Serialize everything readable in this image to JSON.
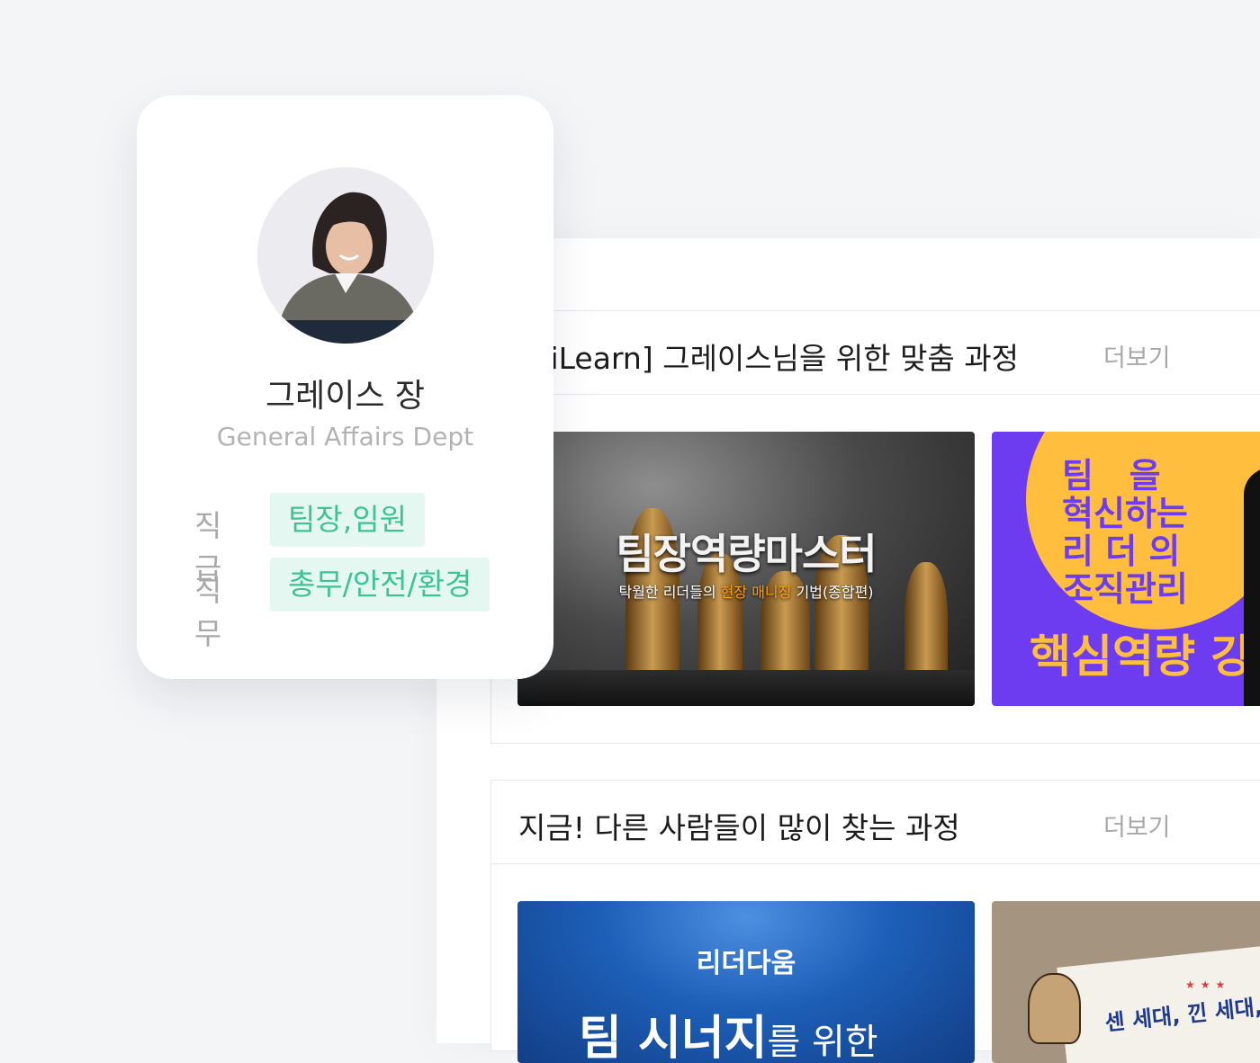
{
  "profile": {
    "name": "그레이스 장",
    "department": "General Affairs Dept",
    "rank_label": "직급",
    "rank_value": "팀장,임원",
    "job_label": "직무",
    "job_value": "총무/안전/환경"
  },
  "sections": [
    {
      "title": "[AiLearn] 그레이스님을 위한 맞춤 과정",
      "more": "더보기",
      "courses": [
        {
          "title": "팀장역량마스터",
          "sub_pre": "탁월한 리더들의 ",
          "sub_highlight": "현장 매니징",
          "sub_post": " 기법(종합편)"
        },
        {
          "lines": "팀   을\n혁신하는\n리 더 의\n조직관리",
          "big": "핵심역량 강"
        }
      ]
    },
    {
      "title": "지금! 다른 사람들이 많이 찾는 과정",
      "more": "더보기",
      "courses": [
        {
          "logo": "리더다움",
          "title_bold": "팀 시너지",
          "title_thin": "를 위한"
        },
        {
          "title": "센 세대, 낀 세대, 신"
        }
      ]
    }
  ],
  "colors": {
    "tag_bg": "#e4f8f1",
    "tag_text": "#3ec293",
    "highlight": "#ff9c1a",
    "purple": "#6d3cf0",
    "yellow": "#ffbe3d"
  }
}
